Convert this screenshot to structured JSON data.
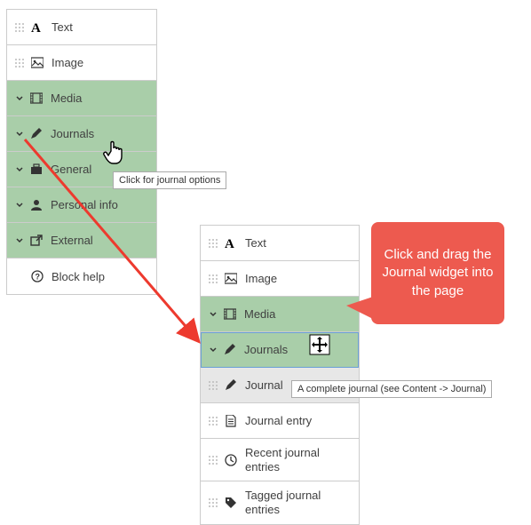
{
  "panel_top": {
    "items": [
      {
        "label": "Text",
        "icon": "text-icon",
        "section": false
      },
      {
        "label": "Image",
        "icon": "image-icon",
        "section": false
      },
      {
        "label": "Media",
        "icon": "film-icon",
        "section": true
      },
      {
        "label": "Journals",
        "icon": "pencil-icon",
        "section": true
      },
      {
        "label": "General",
        "icon": "briefcase-icon",
        "section": true
      },
      {
        "label": "Personal info",
        "icon": "person-icon",
        "section": true
      },
      {
        "label": "External",
        "icon": "external-icon",
        "section": true
      },
      {
        "label": "Block help",
        "icon": "help-icon",
        "section": false
      }
    ]
  },
  "panel_bottom": {
    "items": [
      {
        "label": "Text",
        "icon": "text-icon",
        "section": false
      },
      {
        "label": "Image",
        "icon": "image-icon",
        "section": false
      },
      {
        "label": "Media",
        "icon": "film-icon",
        "section": true
      },
      {
        "label": "Journals",
        "icon": "pencil-icon",
        "section": true,
        "active": true
      },
      {
        "label": "Journal",
        "icon": "pencil-icon",
        "sub": true,
        "hover": true
      },
      {
        "label": "Journal entry",
        "icon": "file-icon",
        "sub": true
      },
      {
        "label": "Recent journal entries",
        "icon": "clock-icon",
        "sub": true
      },
      {
        "label": "Tagged journal entries",
        "icon": "tag-icon",
        "sub": true
      }
    ]
  },
  "tooltip_top": "Click for journal options",
  "tooltip_bottom": "A complete journal (see Content -> Journal)",
  "callout_text": "Click and drag the Journal widget into the page"
}
